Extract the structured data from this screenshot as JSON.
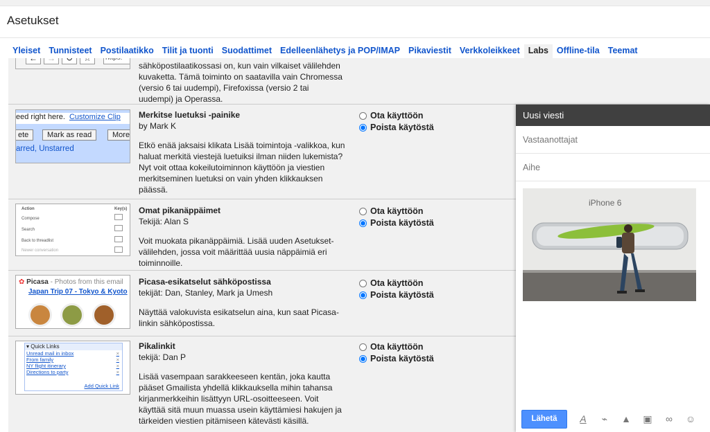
{
  "page": {
    "title": "Asetukset"
  },
  "tabs": [
    {
      "label": "Yleiset"
    },
    {
      "label": "Tunnisteet"
    },
    {
      "label": "Postilaatikko"
    },
    {
      "label": "Tilit ja tuonti"
    },
    {
      "label": "Suodattimet"
    },
    {
      "label": "Edelleenlähetys ja POP/IMAP"
    },
    {
      "label": "Pikaviestit"
    },
    {
      "label": "Verkkoleikkeet"
    },
    {
      "label": "Labs",
      "active": true
    },
    {
      "label": "Offline-tila"
    },
    {
      "label": "Teemat"
    }
  ],
  "labs": {
    "enable_label": "Ota käyttöön",
    "disable_label": "Poista käytöstä",
    "partial": {
      "desc_lines": [
        "sähköpostilaatikossasi on, kun vain vilkaiset välilehden",
        "kuvaketta. Tämä toiminto on saatavilla vain Chromessa",
        "(versio 6 tai uudempi), Firefoxissa (versio 2 tai",
        "uudempi) ja Operassa."
      ],
      "thumb_url": "https:"
    },
    "items": [
      {
        "name": "Merkitse luetuksi -painike",
        "author": "by Mark K",
        "desc": "Etkö enää jaksaisi klikata Lisää toimintoja -valikkoa, kun haluat merkitä viestejä luetuiksi ilman niiden lukemista? Nyt voit ottaa kokeilutoiminnon käyttöön ja viestien merkitseminen luetuksi on vain yhden klikkauksen päässä.",
        "thumb": {
          "line1": "eed right here.",
          "link": "Customize Clip",
          "b1": "ete",
          "b2": "Mark as read",
          "b3": "More",
          "line3": "arred, Unstarred"
        }
      },
      {
        "name": "Omat pikanäppäimet",
        "author": "Tekijä: Alan S",
        "desc": "Voit muokata pikanäppäimiä. Lisää uuden Asetukset-välilehden, jossa voit määrittää uusia näppäimiä eri toiminnoille.",
        "thumb": {
          "h1": "Action",
          "h2": "Key(s)",
          "r1": "Compose",
          "r2": "Search",
          "r3": "Back to threadlist",
          "r4": "Newer conversation"
        }
      },
      {
        "name": "Picasa-esikatselut sähköpostissa",
        "author": "tekijät: Dan, Stanley, Mark ja Umesh",
        "desc": "Näyttää valokuvista esikatselun aina, kun saat Picasa-linkin sähköpostissa.",
        "thumb": {
          "brand": "Picasa",
          "sub": " - Photos from this email",
          "link": "Japan Trip 07 - Tokyo & Kyoto"
        }
      },
      {
        "name": "Pikalinkit",
        "author": "tekijä: Dan P",
        "desc": "Lisää vasempaan sarakkeeseen kentän, joka kautta pääset Gmailista yhdellä klikkauksella mihin tahansa kirjanmerkkeihin lisättyyn URL-osoitteeseen. Voit käyttää sitä muun muassa usein käyttämiesi hakujen ja tärkeiden viestien pitämiseen kätevästi käsillä.",
        "thumb": {
          "header": "▾ Quick Links",
          "links": [
            "Unread mail in inbox",
            "From family",
            "NY flight itinerary",
            "Directions to party"
          ],
          "add": "Add Quick Link"
        }
      }
    ]
  },
  "compose": {
    "title": "Uusi viesti",
    "to_placeholder": "Vastaanottajat",
    "subject_placeholder": "Aihe",
    "photo_text": "iPhone 6",
    "send_label": "Lähetä",
    "icons": [
      "format-text-icon",
      "attach-icon",
      "drive-icon",
      "photo-icon",
      "link-icon",
      "emoji-icon"
    ]
  }
}
